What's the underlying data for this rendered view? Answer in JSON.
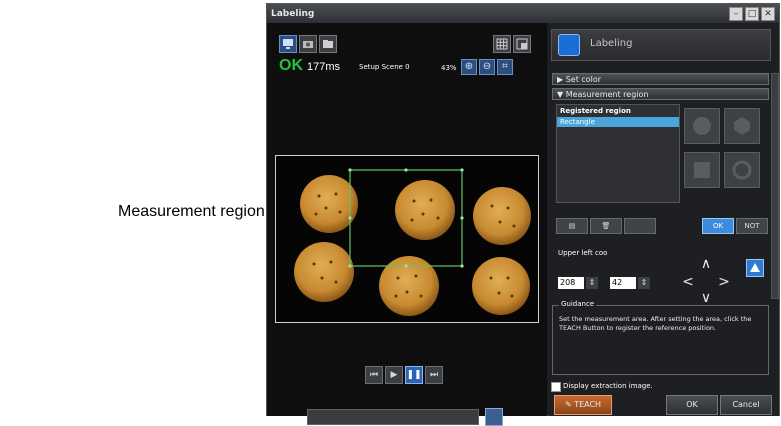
{
  "annotation": {
    "label": "Measurement region"
  },
  "window": {
    "title": "Labeling",
    "controls": [
      "–",
      "□",
      "✕"
    ]
  },
  "status": {
    "result": "OK",
    "time": "177ms",
    "scene": "Setup Scene 0",
    "zoom": "43%"
  },
  "panel": {
    "title": "Labeling"
  },
  "sections": {
    "set_color": "▶ Set color",
    "measurement_region": "▼ Measurement region"
  },
  "region_list": {
    "header": "Registered region",
    "items": [
      "Rectangle"
    ]
  },
  "region_buttons": {
    "ok": "OK",
    "not": "NOT"
  },
  "position": {
    "label": "Upper left coo",
    "x": "208",
    "y": "42"
  },
  "guidance": {
    "legend": "Guidance",
    "text": "Set the measurement area. After setting the area, click the TEACH Button to register the reference position."
  },
  "display_extraction": {
    "label": "Display extraction image."
  },
  "buttons": {
    "teach": "TEACH",
    "ok": "OK",
    "cancel": "Cancel"
  },
  "colors": {
    "ok_green": "#25c03d",
    "accent_blue": "#3d8bdc",
    "teach_orange": "#c86a2e",
    "callout_red": "#d03030"
  }
}
